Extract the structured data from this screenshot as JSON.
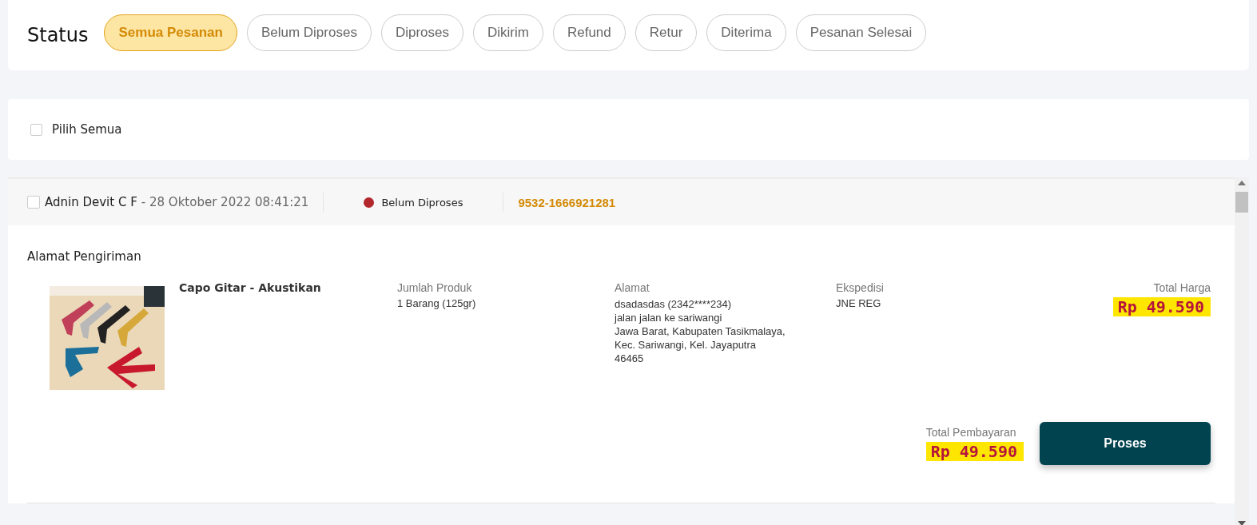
{
  "status_filter": {
    "title": "Status",
    "tabs": [
      {
        "label": "Semua Pesanan",
        "selected": true
      },
      {
        "label": "Belum Diproses",
        "selected": false
      },
      {
        "label": "Diproses",
        "selected": false
      },
      {
        "label": "Dikirim",
        "selected": false
      },
      {
        "label": "Refund",
        "selected": false
      },
      {
        "label": "Retur",
        "selected": false
      },
      {
        "label": "Diterima",
        "selected": false
      },
      {
        "label": "Pesanan Selesai",
        "selected": false
      }
    ]
  },
  "select_all": {
    "label": "Pilih Semua",
    "checked": false
  },
  "orders": [
    {
      "checked": false,
      "buyer": "Adnin Devit C F",
      "date": "- 28 Oktober 2022 08:41:21",
      "status": "Belum Diproses",
      "color": "#b3262b",
      "order_number": "9532-1666921281",
      "section_title": "Alamat Pengiriman",
      "product": {
        "kind": "picture",
        "name": "Capo Gitar - Akustikan"
      },
      "quantity": {
        "label": "Jumlah Produk",
        "value": "1 Barang (125gr)"
      },
      "address": {
        "label": "Alamat",
        "lines": [
          "dsadasdas (2342****234)",
          "jalan jalan ke sariwangi",
          "Jawa Barat, Kabupaten Tasikmalaya,",
          "Kec. Sariwangi, Kel. Jayaputra",
          "46465"
        ]
      },
      "courier": {
        "label": "Ekspedisi",
        "value": "JNE REG"
      },
      "total_price": {
        "label": "Total Harga",
        "value": "Rp 49.590"
      },
      "total_payment": {
        "label": "Total Pembayaran",
        "value": "Rp 49.590"
      },
      "action": "Proses"
    }
  ]
}
